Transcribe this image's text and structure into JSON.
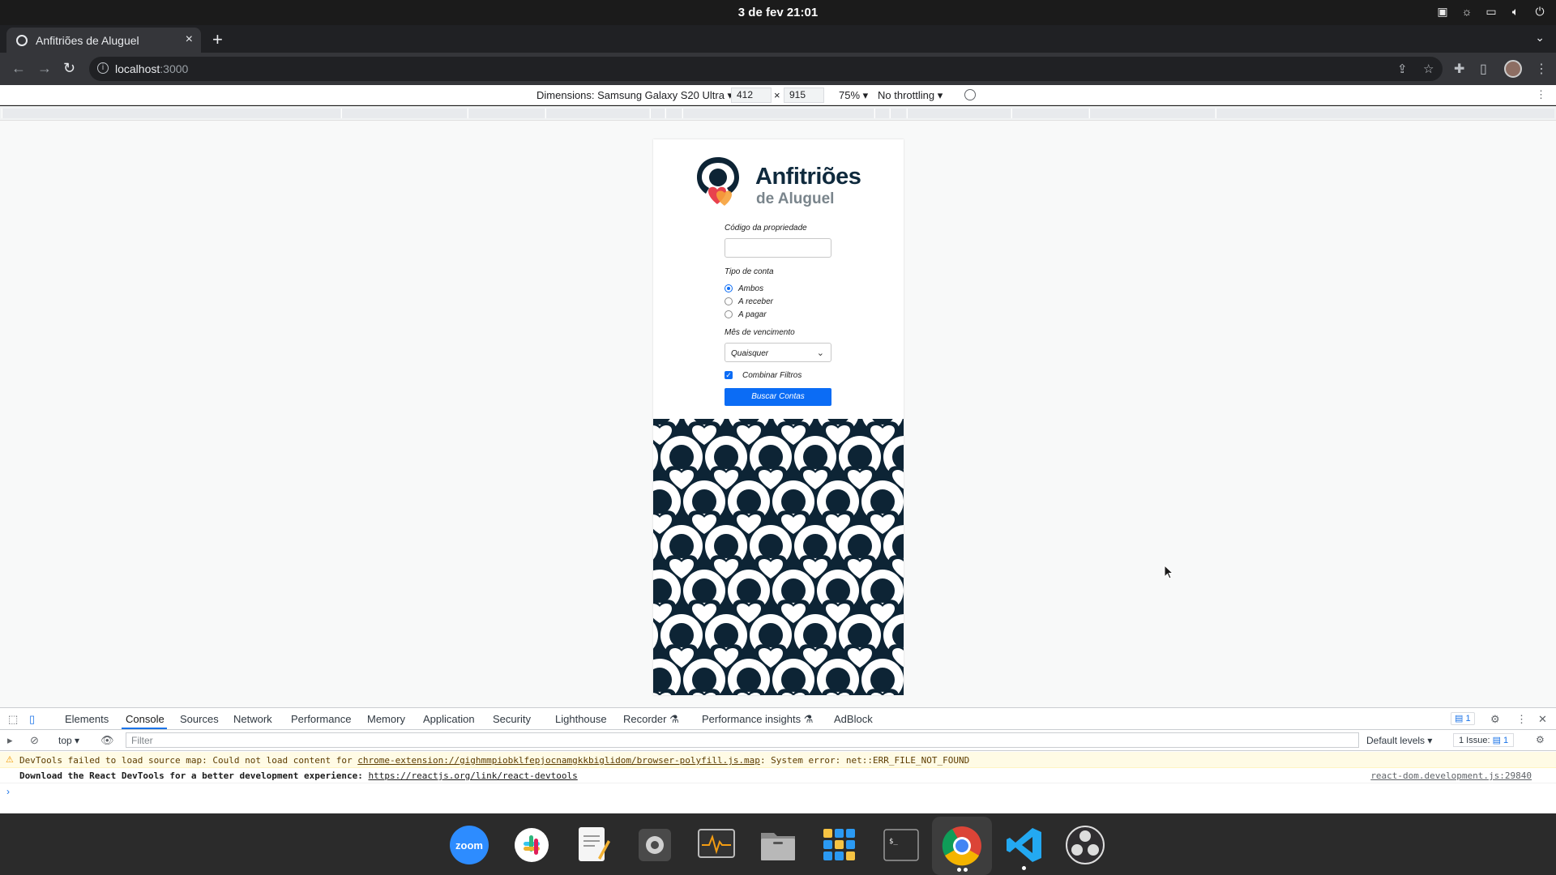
{
  "system": {
    "datetime": "3 de fev  21:01"
  },
  "browser": {
    "tab_title": "Anfitriões de Aluguel",
    "url_host": "localhost",
    "url_port": ":3000"
  },
  "device_toolbar": {
    "dimensions_label": "Dimensions: Samsung Galaxy S20 Ultra",
    "width": "412",
    "times": "×",
    "height": "915",
    "zoom": "75%",
    "throttling": "No throttling"
  },
  "app": {
    "brand_line1": "Anfitriões",
    "brand_line2": "de Aluguel",
    "property_code_label": "Código da propriedade",
    "property_code_value": "",
    "account_type_label": "Tipo de conta",
    "account_types": [
      {
        "label": "Ambos",
        "selected": true
      },
      {
        "label": "A receber",
        "selected": false
      },
      {
        "label": "A pagar",
        "selected": false
      }
    ],
    "due_month_label": "Mês de vencimento",
    "due_month_value": "Quaisquer",
    "combine_filters_label": "Combinar Filtros",
    "combine_filters_checked": true,
    "search_button": "Buscar Contas",
    "colors": {
      "brand_navy": "#0d2435",
      "accent_blue": "#0b6cf5",
      "heart_red": "#e8414d",
      "heart_orange": "#f6a13a"
    }
  },
  "devtools": {
    "tabs": [
      "Elements",
      "Console",
      "Sources",
      "Network",
      "Performance",
      "Memory",
      "Application",
      "Security",
      "Lighthouse",
      "Recorder",
      "Performance insights",
      "AdBlock"
    ],
    "active_tab": "Console",
    "tab_badge": "1",
    "context": "top",
    "filter_placeholder": "Filter",
    "levels": "Default levels",
    "issues": "1 Issue:",
    "issues_count": "1",
    "warning_prefix": "DevTools failed to load source map: Could not load content for ",
    "warning_link": "chrome-extension://gighmmpiobklfepjocnamgkkbiglidom/browser-polyfill.js.map",
    "warning_suffix": ": System error: net::ERR_FILE_NOT_FOUND",
    "info_text": "Download the React DevTools for a better development experience: ",
    "info_link": "https://reactjs.org/link/react-devtools",
    "info_source": "react-dom.development.js:29840"
  },
  "dock": {
    "apps": [
      "zoom",
      "slack",
      "text-editor",
      "settings",
      "system-monitor",
      "files",
      "app-grid",
      "terminal",
      "chrome",
      "vscode",
      "obs"
    ]
  }
}
